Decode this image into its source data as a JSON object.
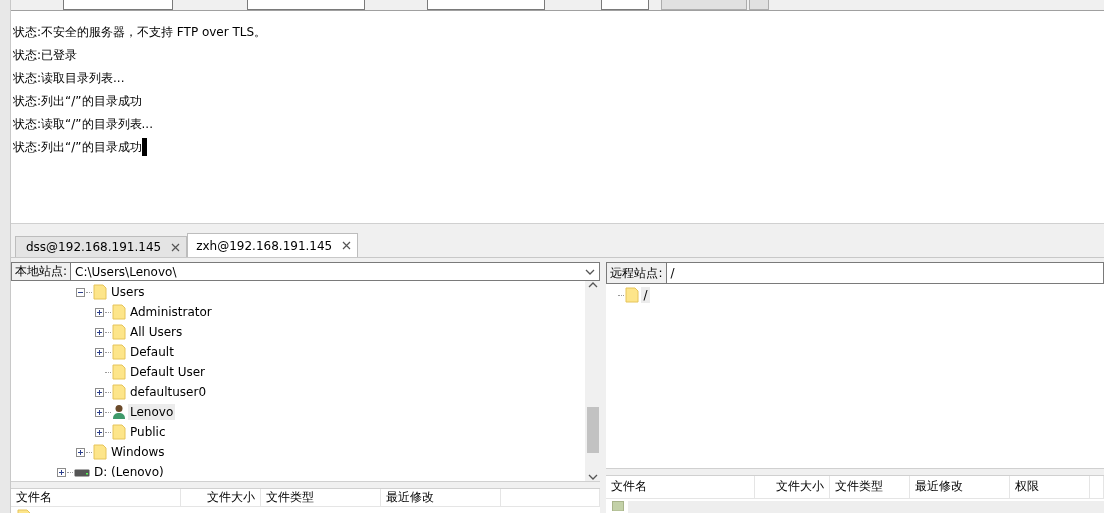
{
  "log": {
    "lines": [
      "状态:不安全的服务器，不支持 FTP over TLS。",
      "状态:已登录",
      "状态:读取目录列表...",
      "状态:列出“/”的目录成功",
      "状态:读取“/”的目录列表...",
      "状态:列出“/”的目录成功"
    ]
  },
  "tabs": [
    {
      "label": "dss@192.168.191.145",
      "selected": false
    },
    {
      "label": "zxh@192.168.191.145",
      "selected": true
    }
  ],
  "local": {
    "address_label": "本地站点:",
    "path": "C:\\Users\\Lenovo\\",
    "tree": [
      {
        "kind": "hidden",
        "children": [
          {
            "label": "Users",
            "kind": "folder",
            "expanded": true,
            "selected": false,
            "children": [
              {
                "label": "Administrator",
                "kind": "folder",
                "expanded": false,
                "selected": false
              },
              {
                "label": "All Users",
                "kind": "folder",
                "expanded": false,
                "selected": false
              },
              {
                "label": "Default",
                "kind": "folder",
                "expanded": false,
                "selected": false
              },
              {
                "label": "Default User",
                "kind": "folder",
                "selected": false
              },
              {
                "label": "defaultuser0",
                "kind": "folder",
                "expanded": false,
                "selected": false
              },
              {
                "label": "Lenovo",
                "kind": "user",
                "expanded": false,
                "selected": true
              },
              {
                "label": "Public",
                "kind": "folder",
                "expanded": false,
                "selected": false
              }
            ]
          },
          {
            "label": "Windows",
            "kind": "folder",
            "expanded": false,
            "selected": false
          }
        ]
      },
      {
        "label": "D: (Lenovo)",
        "kind": "drive",
        "expanded": false,
        "selected": false
      }
    ],
    "columns": [
      "文件名",
      "文件大小",
      "文件类型",
      "最近修改"
    ]
  },
  "remote": {
    "address_label": "远程站点:",
    "path": "/",
    "tree": [
      {
        "label": "/",
        "kind": "folder",
        "selected": true
      }
    ],
    "columns": [
      "文件名",
      "文件大小",
      "文件类型",
      "最近修改",
      "权限"
    ]
  }
}
